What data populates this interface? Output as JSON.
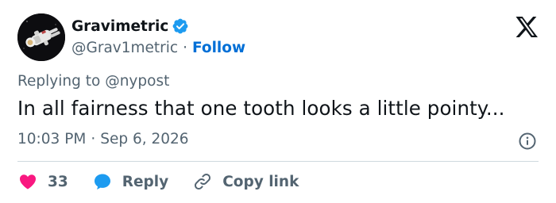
{
  "author": {
    "display_name": "Gravimetric",
    "handle": "@Grav1metric",
    "separator": "·",
    "follow_label": "Follow",
    "verified_icon": "verified-badge-icon",
    "avatar_icon": "astronaut-avatar"
  },
  "brand": {
    "logo_icon": "x-logo-icon"
  },
  "tweet": {
    "replying_prefix": "Replying to",
    "replying_to": "@nypost",
    "text": "In all fairness that one tooth looks a little pointy...",
    "time": "10:03 PM",
    "separator": "·",
    "date": "Sep 6, 2026",
    "info_icon": "info-icon"
  },
  "actions": {
    "like_count": "33",
    "like_icon": "heart-icon",
    "reply_label": "Reply",
    "reply_icon": "reply-bubble-icon",
    "copy_label": "Copy link",
    "copy_icon": "link-icon"
  },
  "colors": {
    "text_primary": "#0f1419",
    "text_secondary": "#536471",
    "link_blue": "#006fd6",
    "verified_blue": "#1d9bf0",
    "like_pink": "#f91880",
    "divider": "#cfd9de"
  }
}
